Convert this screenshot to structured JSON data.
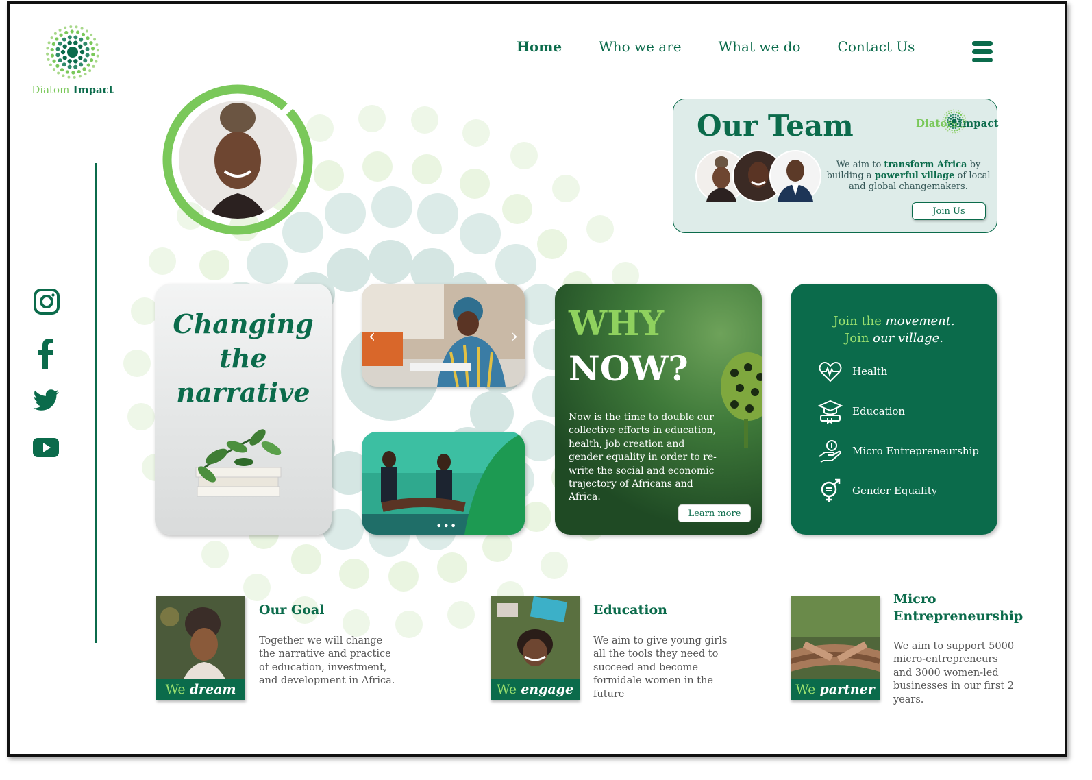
{
  "brand": {
    "name_part1": "Diatom",
    "name_part2": "Impact"
  },
  "nav": {
    "items": [
      {
        "label": "Home"
      },
      {
        "label": "Who we are"
      },
      {
        "label": "What we do"
      },
      {
        "label": "Contact Us"
      }
    ]
  },
  "social": [
    "instagram-icon",
    "facebook-icon",
    "twitter-icon",
    "youtube-icon"
  ],
  "team": {
    "title": "Our Team",
    "desc_1": "We aim to ",
    "desc_bold1": "transform Africa",
    "desc_2": " by building a ",
    "desc_bold2": "powerful village",
    "desc_3": " of local and global changemakers.",
    "join_label": "Join Us"
  },
  "narrative": {
    "line1": "Changing",
    "line2": "the",
    "line3": "narrative"
  },
  "why": {
    "title1": "WHY",
    "title2": "NOW?",
    "description": "Now is the time to double our collective efforts in education, health, job creation and gender equality in order to re-write the social and economic trajectory of Africans and Africa.",
    "learn_label": "Learn more"
  },
  "movement": {
    "join_the": "Join the ",
    "movement": "movement",
    "period": ".",
    "join": "Join ",
    "village": "our village.",
    "items": [
      {
        "label": "Health",
        "icon": "heartbeat-icon"
      },
      {
        "label": "Education",
        "icon": "graduation-cap-icon"
      },
      {
        "label": "Micro Entrepreneurship",
        "icon": "hand-coin-icon"
      },
      {
        "label": "Gender Equality",
        "icon": "gender-icon"
      }
    ]
  },
  "features": [
    {
      "tag_plain": "We ",
      "tag_em": "dream",
      "title": "Our Goal",
      "desc": "Together we will change the narrative and practice of education, investment, and development in Africa."
    },
    {
      "tag_plain": "We ",
      "tag_em": "engage",
      "title": "Education",
      "desc": "We aim to give young girls all the tools they need to succeed and become formidale women in the future"
    },
    {
      "tag_plain": "We ",
      "tag_em": "partner",
      "title": "Micro Entrepreneurship",
      "desc": "We aim to support 5000 micro-entrepreneurs and 3000 women-led businesses in our first 2 years."
    }
  ],
  "colors": {
    "primary": "#0b6b4b",
    "accent": "#7ac85a",
    "card_bg": "#deece9"
  }
}
